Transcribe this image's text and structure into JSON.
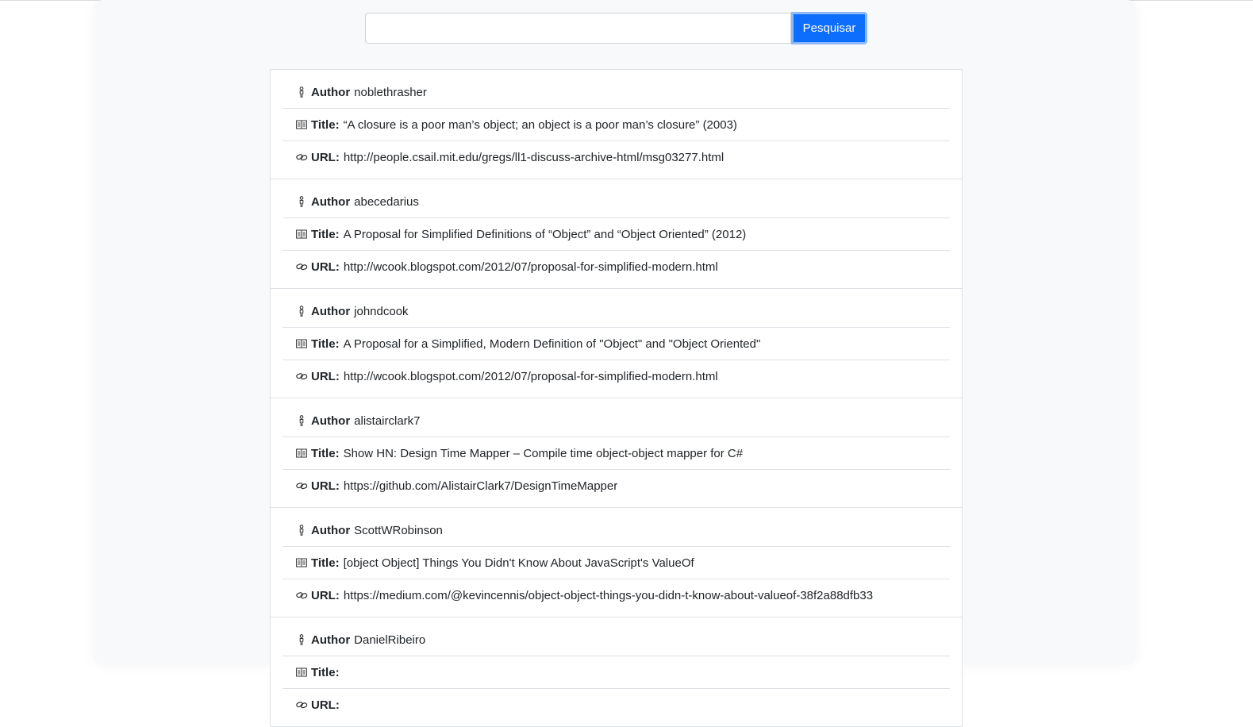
{
  "search": {
    "value": "",
    "button_label": "Pesquisar"
  },
  "labels": {
    "author": "Author",
    "title": "Title:",
    "url": "URL:"
  },
  "icons": {
    "author": "person-icon",
    "title": "book-icon",
    "url": "link-icon"
  },
  "results": [
    {
      "author": "noblethrasher",
      "title": "“A closure is a poor man’s object; an object is a poor man’s closure” (2003)",
      "url": "http://people.csail.mit.edu/gregs/ll1-discuss-archive-html/msg03277.html"
    },
    {
      "author": "abecedarius",
      "title": "A Proposal for Simplified Definitions of “Object” and “Object Oriented” (2012)",
      "url": "http://wcook.blogspot.com/2012/07/proposal-for-simplified-modern.html"
    },
    {
      "author": "johndcook",
      "title": "A Proposal for a Simplified, Modern Definition of \"Object\" and \"Object Oriented\"",
      "url": "http://wcook.blogspot.com/2012/07/proposal-for-simplified-modern.html"
    },
    {
      "author": "alistairclark7",
      "title": "Show HN: Design Time Mapper – Compile time object-object mapper for C#",
      "url": "https://github.com/AlistairClark7/DesignTimeMapper"
    },
    {
      "author": "ScottWRobinson",
      "title": "[object Object] Things You Didn't Know About JavaScript's ValueOf",
      "url": "https://medium.com/@kevincennis/object-object-things-you-didn-t-know-about-valueof-38f2a88dfb33"
    },
    {
      "author": "DanielRibeiro",
      "title": "",
      "url": ""
    }
  ]
}
